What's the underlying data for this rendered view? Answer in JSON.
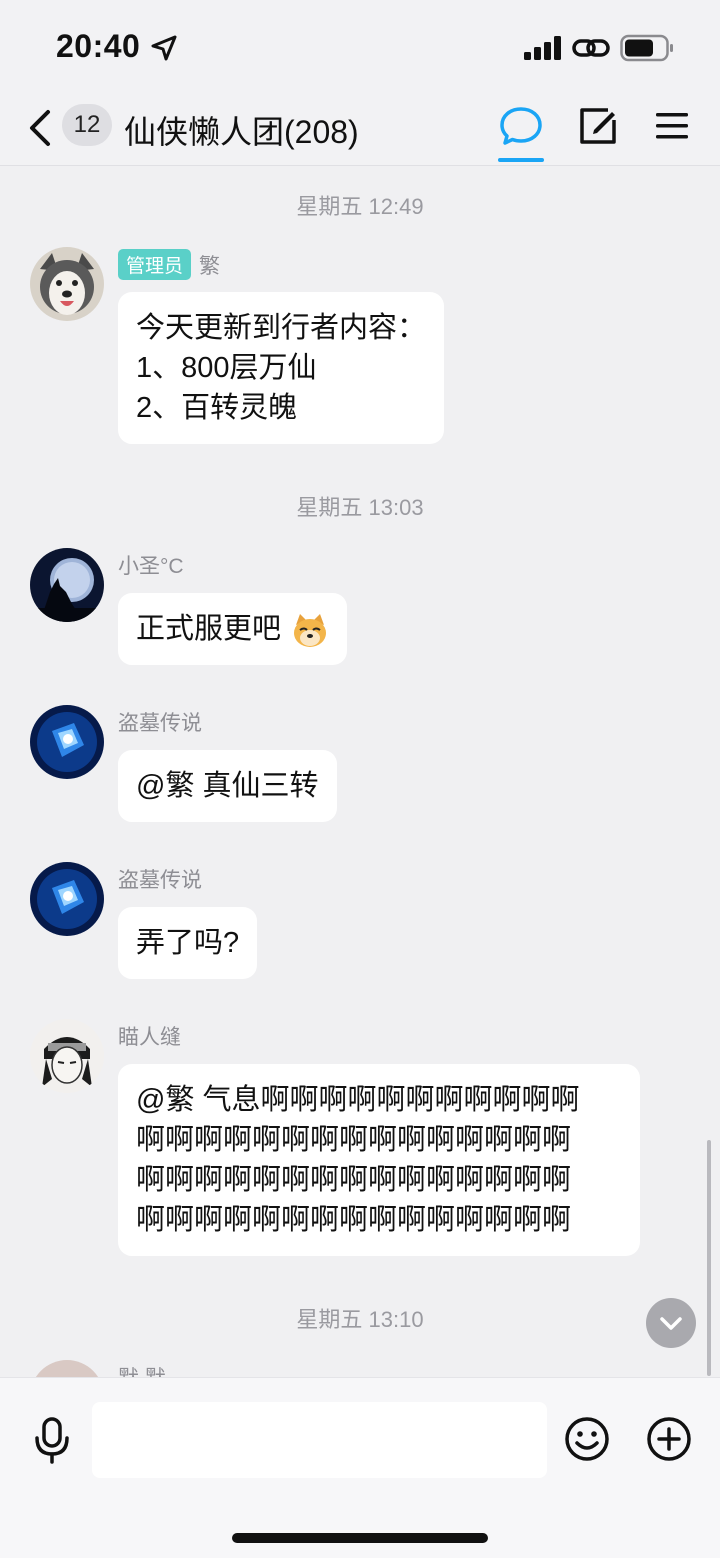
{
  "status_bar": {
    "time": "20:40"
  },
  "header": {
    "unread_count": "12",
    "title": "仙侠懒人团(208)"
  },
  "messages": {
    "sep1": "星期五 12:49",
    "msg1": {
      "role": "管理员",
      "sender": "繁",
      "lines": [
        "今天更新到行者内容：",
        "1、800层万仙",
        "2、百转灵魄"
      ]
    },
    "sep2": "星期五 13:03",
    "msg2": {
      "sender": "小圣°C",
      "text": "正式服更吧"
    },
    "msg3": {
      "sender": "盗墓传说",
      "text": "@繁 真仙三转"
    },
    "msg4": {
      "sender": "盗墓传说",
      "text": "弄了吗?"
    },
    "msg5": {
      "sender": "瞄人缝",
      "lines": [
        "@繁 气息啊啊啊啊啊啊啊啊啊啊啊",
        "啊啊啊啊啊啊啊啊啊啊啊啊啊啊啊",
        "啊啊啊啊啊啊啊啊啊啊啊啊啊啊啊",
        "啊啊啊啊啊啊啊啊啊啊啊啊啊啊啊"
      ]
    },
    "sep3": "星期五 13:10",
    "msg6": {
      "sender": "默 默"
    }
  },
  "input": {
    "placeholder": ""
  },
  "colors": {
    "accent": "#1aa5f5",
    "admin_badge": "#5ad0c8",
    "background": "#f0f0f2",
    "bubble": "#ffffff"
  }
}
